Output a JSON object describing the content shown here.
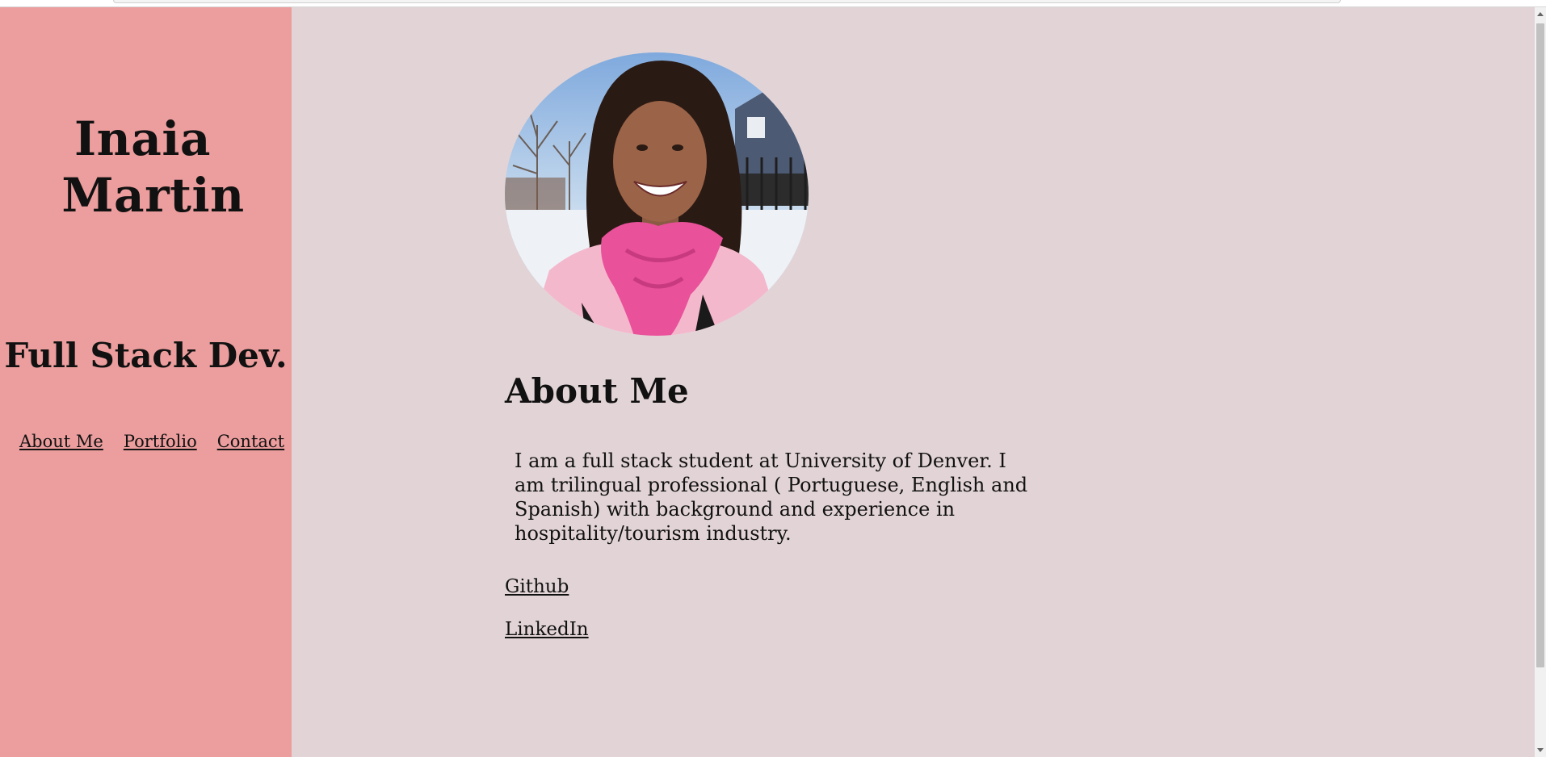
{
  "sidebar": {
    "name_line1": "Inaia",
    "name_line2": "Martin",
    "role": "Full Stack Dev.",
    "nav": {
      "about": "About Me",
      "portfolio": "Portfolio",
      "contact": "Contact"
    }
  },
  "main": {
    "section_title": "About Me",
    "bio": "I am a full stack student at University of Denver. I am trilingual professional ( Portuguese, English and Spanish) with background and experience in hospitality/tourism industry.",
    "links": {
      "github": "Github",
      "linkedin": "LinkedIn"
    }
  },
  "colors": {
    "sidebar_bg": "#ec9d9d",
    "page_bg": "#e2d4d6",
    "text": "#111111"
  },
  "icons": [
    "profile-photo"
  ]
}
